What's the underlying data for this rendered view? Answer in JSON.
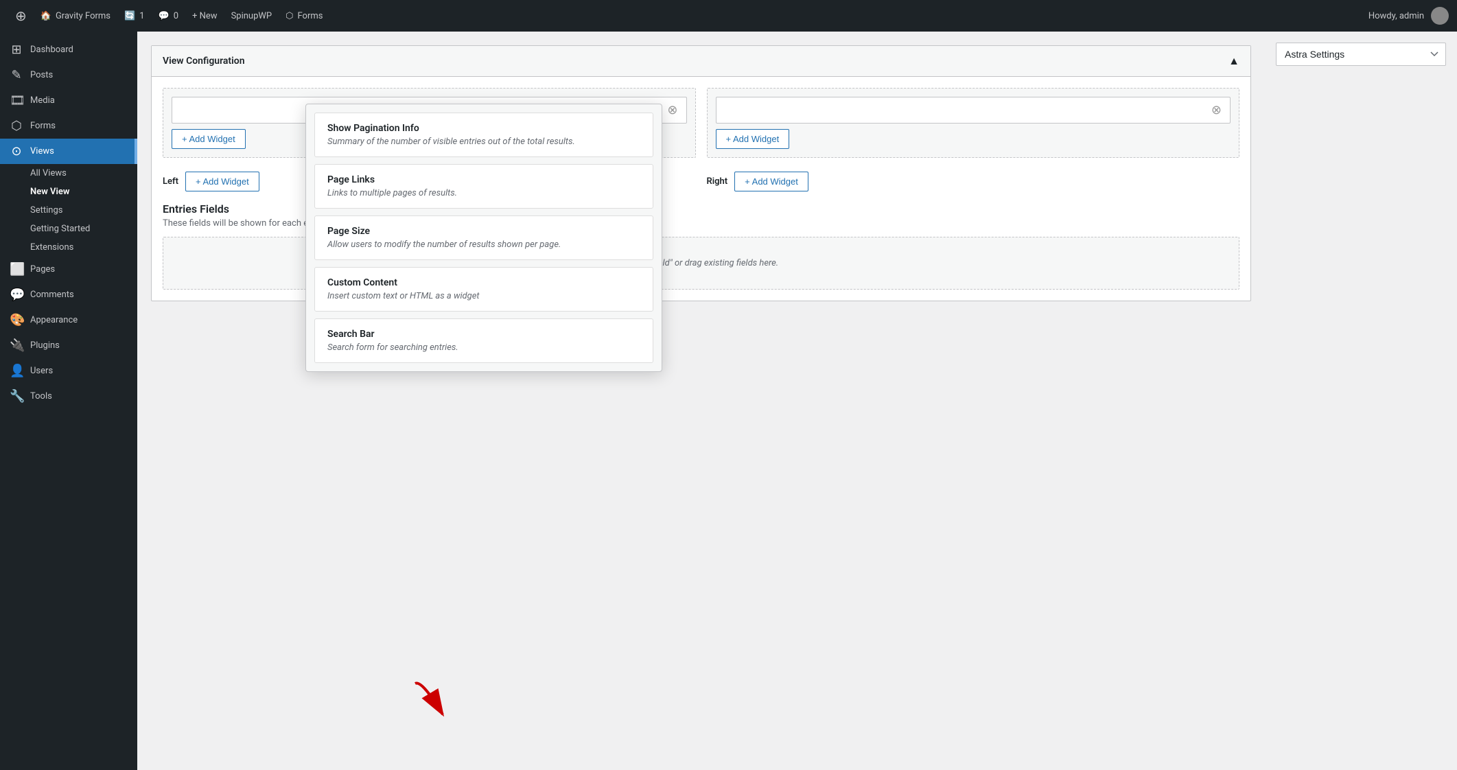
{
  "adminbar": {
    "wp_icon": "⊕",
    "site_name": "Gravity Forms",
    "updates_count": "1",
    "comments_count": "0",
    "new_label": "+ New",
    "spinupwp_label": "SpinupWP",
    "forms_label": "Forms",
    "howdy": "Howdy, admin"
  },
  "sidebar": {
    "items": [
      {
        "label": "Dashboard",
        "icon": "⊞",
        "active": false
      },
      {
        "label": "Posts",
        "icon": "✎",
        "active": false
      },
      {
        "label": "Media",
        "icon": "🎞",
        "active": false
      },
      {
        "label": "Forms",
        "icon": "⬡",
        "active": false
      },
      {
        "label": "Views",
        "icon": "⊙",
        "active": true
      },
      {
        "label": "Pages",
        "icon": "⬜",
        "active": false
      },
      {
        "label": "Comments",
        "icon": "💬",
        "active": false
      },
      {
        "label": "Appearance",
        "icon": "🎨",
        "active": false
      },
      {
        "label": "Plugins",
        "icon": "🔌",
        "active": false
      },
      {
        "label": "Users",
        "icon": "👤",
        "active": false
      },
      {
        "label": "Tools",
        "icon": "🔧",
        "active": false
      }
    ],
    "submenu": [
      {
        "label": "All Views",
        "active": false
      },
      {
        "label": "New View",
        "active": true
      },
      {
        "label": "Settings",
        "active": false
      },
      {
        "label": "Getting Started",
        "active": false
      },
      {
        "label": "Extensions",
        "active": false
      }
    ]
  },
  "main": {
    "view_config_title": "View Configuration",
    "widget_zones": [
      {
        "label": "Left",
        "add_btn": "+ Add Widget"
      },
      {
        "label": "Right",
        "add_btn": "+ Add Widget"
      }
    ],
    "entries_title": "Entries Fields",
    "entries_subtitle": "These fields will be shown for each entry.",
    "entries_drop_placeholder": "\"+ Add Field\" or drag existing fields here.",
    "add_widget_center": "+ Add Widget"
  },
  "widget_chooser": {
    "items": [
      {
        "title": "Show Pagination Info",
        "desc": "Summary of the number of visible entries out of the total results."
      },
      {
        "title": "Page Links",
        "desc": "Links to multiple pages of results."
      },
      {
        "title": "Page Size",
        "desc": "Allow users to modify the number of results shown per page."
      },
      {
        "title": "Custom Content",
        "desc": "Insert custom text or HTML as a widget"
      },
      {
        "title": "Search Bar",
        "desc": "Search form for searching entries."
      }
    ]
  },
  "right_sidebar": {
    "select_label": "Astra Settings",
    "select_placeholder": "Astra Settings"
  }
}
